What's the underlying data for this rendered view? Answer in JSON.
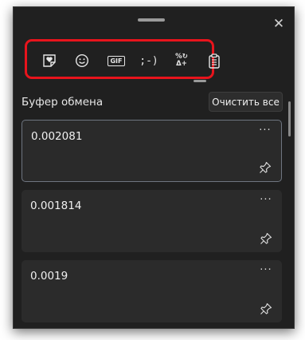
{
  "window": {
    "close_glyph": "✕"
  },
  "tabs": [
    {
      "name": "tab-favorites",
      "icon": "heart-sticker-icon",
      "label": ""
    },
    {
      "name": "tab-emoji",
      "icon": "smiley-icon",
      "label": ""
    },
    {
      "name": "tab-gif",
      "icon": "gif-icon",
      "label": "GIF"
    },
    {
      "name": "tab-kaomoji",
      "icon": "kaomoji-icon",
      "label": ";-)"
    },
    {
      "name": "tab-symbols",
      "icon": "symbols-icon",
      "label": "%↻\nΔ+"
    },
    {
      "name": "tab-clipboard",
      "icon": "clipboard-icon",
      "label": ""
    }
  ],
  "clipboard": {
    "title": "Буфер обмена",
    "clear_all_label": "Очистить все",
    "items": [
      {
        "text": "0.002081",
        "selected": true
      },
      {
        "text": "0.001814",
        "selected": false
      },
      {
        "text": "0.0019",
        "selected": false
      }
    ],
    "more_glyph": "···"
  },
  "colors": {
    "background": "#202020",
    "card": "#2b2b2b",
    "highlight_border": "#e8141c",
    "text": "#f0f0f0"
  }
}
